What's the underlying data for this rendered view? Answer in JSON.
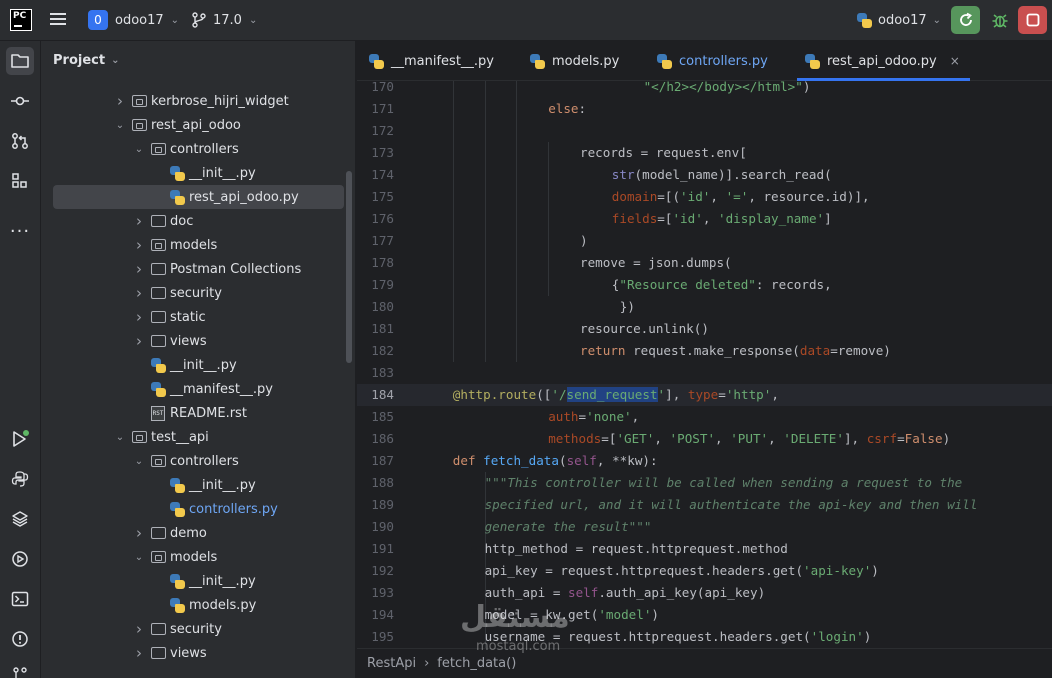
{
  "titlebar": {
    "logo": "PC",
    "project_badge": "0",
    "project_name": "odoo17",
    "branch": "17.0",
    "run_config": "odoo17"
  },
  "toolstrip": {
    "icons": [
      "folder-icon",
      "commit-icon",
      "pull-requests-icon",
      "structure-icon",
      "more-icon",
      "run-icon",
      "python-console-icon",
      "layers-icon",
      "services-icon",
      "terminal-icon",
      "problems-icon",
      "git-icon"
    ]
  },
  "project_panel": {
    "title": "Project",
    "tree": [
      {
        "label": "kerbrose_hijri_widget",
        "type": "module",
        "depth": 3,
        "arrow": "right"
      },
      {
        "label": "rest_api_odoo",
        "type": "module",
        "depth": 3,
        "arrow": "down"
      },
      {
        "label": "controllers",
        "type": "module",
        "depth": 4,
        "arrow": "down"
      },
      {
        "label": "__init__.py",
        "type": "py",
        "depth": 5,
        "arrow": ""
      },
      {
        "label": "rest_api_odoo.py",
        "type": "py",
        "depth": 5,
        "arrow": "",
        "selected": true
      },
      {
        "label": "doc",
        "type": "folder",
        "depth": 4,
        "arrow": "right"
      },
      {
        "label": "models",
        "type": "module",
        "depth": 4,
        "arrow": "right"
      },
      {
        "label": "Postman Collections",
        "type": "folder",
        "depth": 4,
        "arrow": "right"
      },
      {
        "label": "security",
        "type": "folder",
        "depth": 4,
        "arrow": "right"
      },
      {
        "label": "static",
        "type": "folder",
        "depth": 4,
        "arrow": "right"
      },
      {
        "label": "views",
        "type": "folder",
        "depth": 4,
        "arrow": "right"
      },
      {
        "label": "__init__.py",
        "type": "py",
        "depth": 4,
        "arrow": ""
      },
      {
        "label": "__manifest__.py",
        "type": "py",
        "depth": 4,
        "arrow": ""
      },
      {
        "label": "README.rst",
        "type": "rst",
        "depth": 4,
        "arrow": ""
      },
      {
        "label": "test__api",
        "type": "module",
        "depth": 3,
        "arrow": "down"
      },
      {
        "label": "controllers",
        "type": "module",
        "depth": 4,
        "arrow": "down"
      },
      {
        "label": "__init__.py",
        "type": "py",
        "depth": 5,
        "arrow": ""
      },
      {
        "label": "controllers.py",
        "type": "py",
        "depth": 5,
        "arrow": "",
        "modified": true
      },
      {
        "label": "demo",
        "type": "folder",
        "depth": 4,
        "arrow": "right"
      },
      {
        "label": "models",
        "type": "module",
        "depth": 4,
        "arrow": "down"
      },
      {
        "label": "__init__.py",
        "type": "py",
        "depth": 5,
        "arrow": ""
      },
      {
        "label": "models.py",
        "type": "py",
        "depth": 5,
        "arrow": ""
      },
      {
        "label": "security",
        "type": "folder",
        "depth": 4,
        "arrow": "right"
      },
      {
        "label": "views",
        "type": "folder",
        "depth": 4,
        "arrow": "right"
      }
    ]
  },
  "editor": {
    "tabs": [
      {
        "label": "__manifest__.py",
        "active": false,
        "modified": false
      },
      {
        "label": "models.py",
        "active": false,
        "modified": false
      },
      {
        "label": "controllers.py",
        "active": false,
        "modified": true
      },
      {
        "label": "rest_api_odoo.py",
        "active": true,
        "modified": false
      }
    ],
    "close_glyph": "×",
    "current_line": 184,
    "lines": [
      {
        "n": 170,
        "indent": 28,
        "tokens": [
          [
            "s",
            "\"</h2></body></html>\""
          ],
          [
            "",
            ")"
          ]
        ]
      },
      {
        "n": 171,
        "indent": 16,
        "tokens": [
          [
            "k",
            "else"
          ],
          [
            "",
            ":"
          ]
        ]
      },
      {
        "n": 172,
        "indent": 0,
        "tokens": []
      },
      {
        "n": 173,
        "indent": 20,
        "tokens": [
          [
            "",
            "records = request.env["
          ]
        ]
      },
      {
        "n": 174,
        "indent": 24,
        "tokens": [
          [
            "bi",
            "str"
          ],
          [
            "",
            "(model_name)].search_read("
          ]
        ]
      },
      {
        "n": 175,
        "indent": 24,
        "tokens": [
          [
            "p",
            "domain"
          ],
          [
            "",
            "=[("
          ],
          [
            "s",
            "'id'"
          ],
          [
            "",
            ", "
          ],
          [
            "s",
            "'='"
          ],
          [
            "",
            ", resource.id)],"
          ]
        ]
      },
      {
        "n": 176,
        "indent": 24,
        "tokens": [
          [
            "p",
            "fields"
          ],
          [
            "",
            "=["
          ],
          [
            "s",
            "'id'"
          ],
          [
            "",
            ", "
          ],
          [
            "s",
            "'display_name'"
          ],
          [
            "",
            "]"
          ]
        ]
      },
      {
        "n": 177,
        "indent": 20,
        "tokens": [
          [
            "",
            ")"
          ]
        ]
      },
      {
        "n": 178,
        "indent": 20,
        "tokens": [
          [
            "",
            "remove = json.dumps("
          ]
        ]
      },
      {
        "n": 179,
        "indent": 24,
        "tokens": [
          [
            "",
            "{"
          ],
          [
            "s",
            "\"Resource deleted\""
          ],
          [
            "",
            ": records,"
          ]
        ]
      },
      {
        "n": 180,
        "indent": 25,
        "tokens": [
          [
            "",
            "})"
          ]
        ]
      },
      {
        "n": 181,
        "indent": 20,
        "tokens": [
          [
            "",
            "resource.unlink()"
          ]
        ]
      },
      {
        "n": 182,
        "indent": 20,
        "tokens": [
          [
            "k",
            "return"
          ],
          [
            "",
            " request.make_response("
          ],
          [
            "p",
            "data"
          ],
          [
            "",
            "=remove)"
          ]
        ]
      },
      {
        "n": 183,
        "indent": 0,
        "tokens": []
      },
      {
        "n": 184,
        "indent": 4,
        "tokens": [
          [
            "dec",
            "@http.route"
          ],
          [
            "",
            "(["
          ],
          [
            "s",
            "'/"
          ],
          [
            "shl",
            "send_request"
          ],
          [
            "s",
            "'"
          ],
          [
            "",
            "], "
          ],
          [
            "p",
            "type"
          ],
          [
            "",
            "="
          ],
          [
            "s",
            "'http'"
          ],
          [
            "",
            ","
          ]
        ]
      },
      {
        "n": 185,
        "indent": 16,
        "tokens": [
          [
            "p",
            "auth"
          ],
          [
            "",
            "="
          ],
          [
            "s",
            "'none'"
          ],
          [
            "",
            ","
          ]
        ]
      },
      {
        "n": 186,
        "indent": 16,
        "tokens": [
          [
            "p",
            "methods"
          ],
          [
            "",
            "=["
          ],
          [
            "s",
            "'GET'"
          ],
          [
            "",
            ", "
          ],
          [
            "s",
            "'POST'"
          ],
          [
            "",
            ", "
          ],
          [
            "s",
            "'PUT'"
          ],
          [
            "",
            ", "
          ],
          [
            "s",
            "'DELETE'"
          ],
          [
            "",
            "], "
          ],
          [
            "p",
            "csrf"
          ],
          [
            "",
            "="
          ],
          [
            "k",
            "False"
          ],
          [
            "",
            ")"
          ]
        ]
      },
      {
        "n": 187,
        "indent": 4,
        "tokens": [
          [
            "k",
            "def"
          ],
          [
            "",
            " "
          ],
          [
            "fn",
            "fetch_data"
          ],
          [
            "",
            "("
          ],
          [
            "slf",
            "self"
          ],
          [
            "",
            ", **kw):"
          ]
        ]
      },
      {
        "n": 188,
        "indent": 8,
        "tokens": [
          [
            "d",
            "\"\"\"This controller will be called when sending a request to the"
          ]
        ]
      },
      {
        "n": 189,
        "indent": 8,
        "tokens": [
          [
            "d",
            "specified url, and it will authenticate the api-key and then will"
          ]
        ]
      },
      {
        "n": 190,
        "indent": 8,
        "tokens": [
          [
            "d",
            "generate the result\"\"\""
          ]
        ]
      },
      {
        "n": 191,
        "indent": 8,
        "tokens": [
          [
            "",
            "http_method = request.httprequest.method"
          ]
        ]
      },
      {
        "n": 192,
        "indent": 8,
        "tokens": [
          [
            "",
            "api_key = request.httprequest.headers.get("
          ],
          [
            "s",
            "'api-key'"
          ],
          [
            "",
            ")"
          ]
        ]
      },
      {
        "n": 193,
        "indent": 8,
        "tokens": [
          [
            "",
            "auth_api = "
          ],
          [
            "slf",
            "self"
          ],
          [
            "",
            ".auth_api_key(api_key)"
          ]
        ]
      },
      {
        "n": 194,
        "indent": 8,
        "tokens": [
          [
            "",
            "model = kw.get("
          ],
          [
            "s",
            "'model'"
          ],
          [
            "",
            ")"
          ]
        ]
      },
      {
        "n": 195,
        "indent": 8,
        "tokens": [
          [
            "",
            "username = request.httprequest.headers.get("
          ],
          [
            "s",
            "'login'"
          ],
          [
            "",
            ")"
          ]
        ]
      }
    ],
    "breadcrumbs": [
      "RestApi",
      "fetch_data()"
    ],
    "breadcrumb_separator": "›"
  },
  "watermark": {
    "arabic": "مستقل",
    "latin": "mostaql.com"
  },
  "colors": {
    "accent": "#3574f0",
    "run_green": "#57965c",
    "stop_red": "#c94f4f",
    "keyword": "#cf8e6d",
    "string": "#6aab73",
    "docstring": "#5f826b"
  }
}
